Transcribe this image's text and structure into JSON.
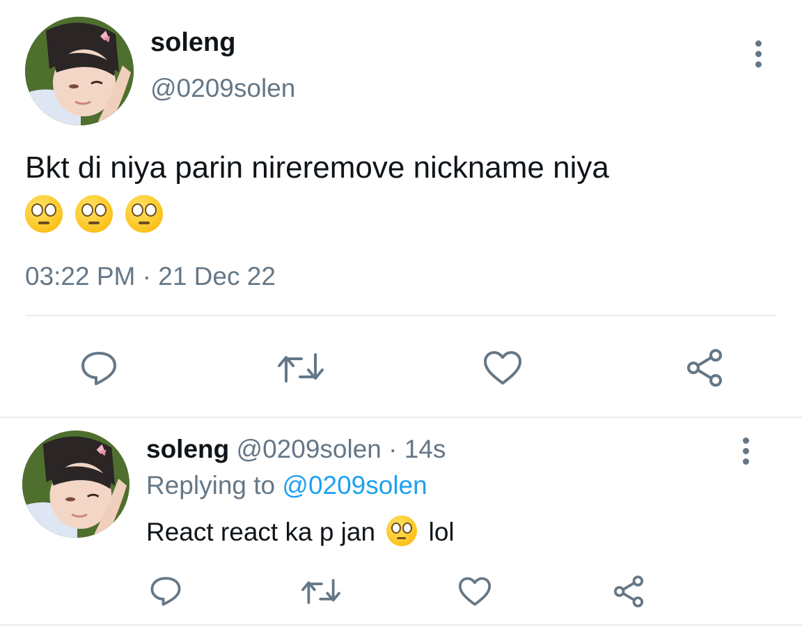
{
  "main_tweet": {
    "display_name": "soleng",
    "handle": "@0209solen",
    "text_line1": "Bkt di niya parin nireremove nickname niya",
    "emoji_count_label": "face-with-rolling-eyes-emoji",
    "timestamp": "03:22 PM · 21 Dec 22"
  },
  "reply_tweet": {
    "display_name": "soleng",
    "handle": "@0209solen",
    "separator": "·",
    "age": "14s",
    "replying_prefix": "Replying to",
    "replying_handle": "@0209solen",
    "text_before": "React react ka p jan",
    "text_after": "lol"
  },
  "actions": {
    "reply_icon": "reply-icon",
    "retweet_icon": "retweet-icon",
    "like_icon": "heart-icon",
    "share_icon": "share-icon",
    "more_icon": "more-vertical-icon"
  },
  "colors": {
    "link": "#1da1f2",
    "muted": "#657786",
    "text": "#0f1419",
    "divider": "#e6ecf0"
  }
}
